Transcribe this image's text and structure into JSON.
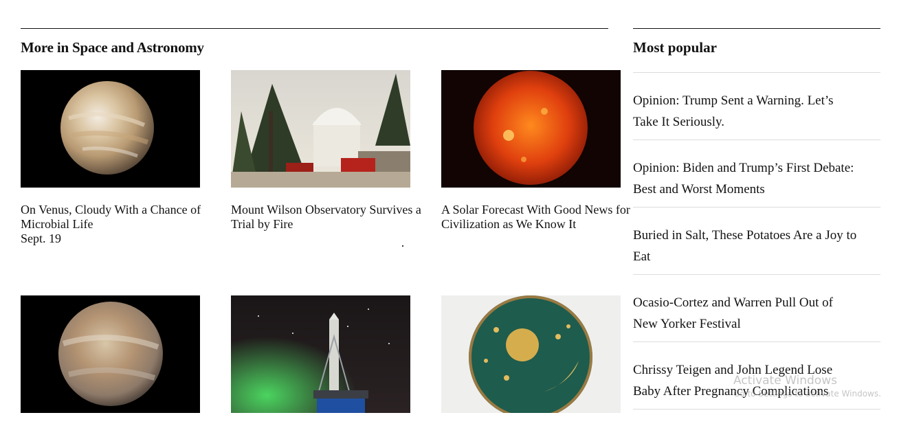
{
  "section": {
    "title": "More in Space and Astronomy"
  },
  "articles": [
    {
      "headline": "On Venus, Cloudy With a Chance of Microbial Life",
      "date": "Sept. 19",
      "image": "venus-planet"
    },
    {
      "headline": "Mount Wilson Observatory Survives a Trial by Fire",
      "date": "",
      "image": "observatory-dome-with-fire-trucks"
    },
    {
      "headline": "A Solar Forecast With Good News for Civilization as We Know It",
      "date": "",
      "image": "sun-surface"
    },
    {
      "headline": "",
      "date": "",
      "image": "venus-planet-alt"
    },
    {
      "headline": "",
      "date": "",
      "image": "rocket-on-launch-pad-night"
    },
    {
      "headline": "",
      "date": "",
      "image": "nebra-sky-disc"
    }
  ],
  "popular": {
    "title": "Most popular",
    "items": [
      "Opinion: Trump Sent a Warning. Let’s Take It Seriously.",
      "Opinion: Biden and Trump’s First Debate: Best and Worst Moments",
      "Buried in Salt, These Potatoes Are a Joy to Eat",
      "Ocasio-Cortez and Warren Pull Out of New Yorker Festival",
      "Chrissy Teigen and John Legend Lose Baby After Pregnancy Complications"
    ]
  },
  "watermark": {
    "line1": "Activate Windows",
    "line2": "Go to Settings to activate Windows."
  }
}
